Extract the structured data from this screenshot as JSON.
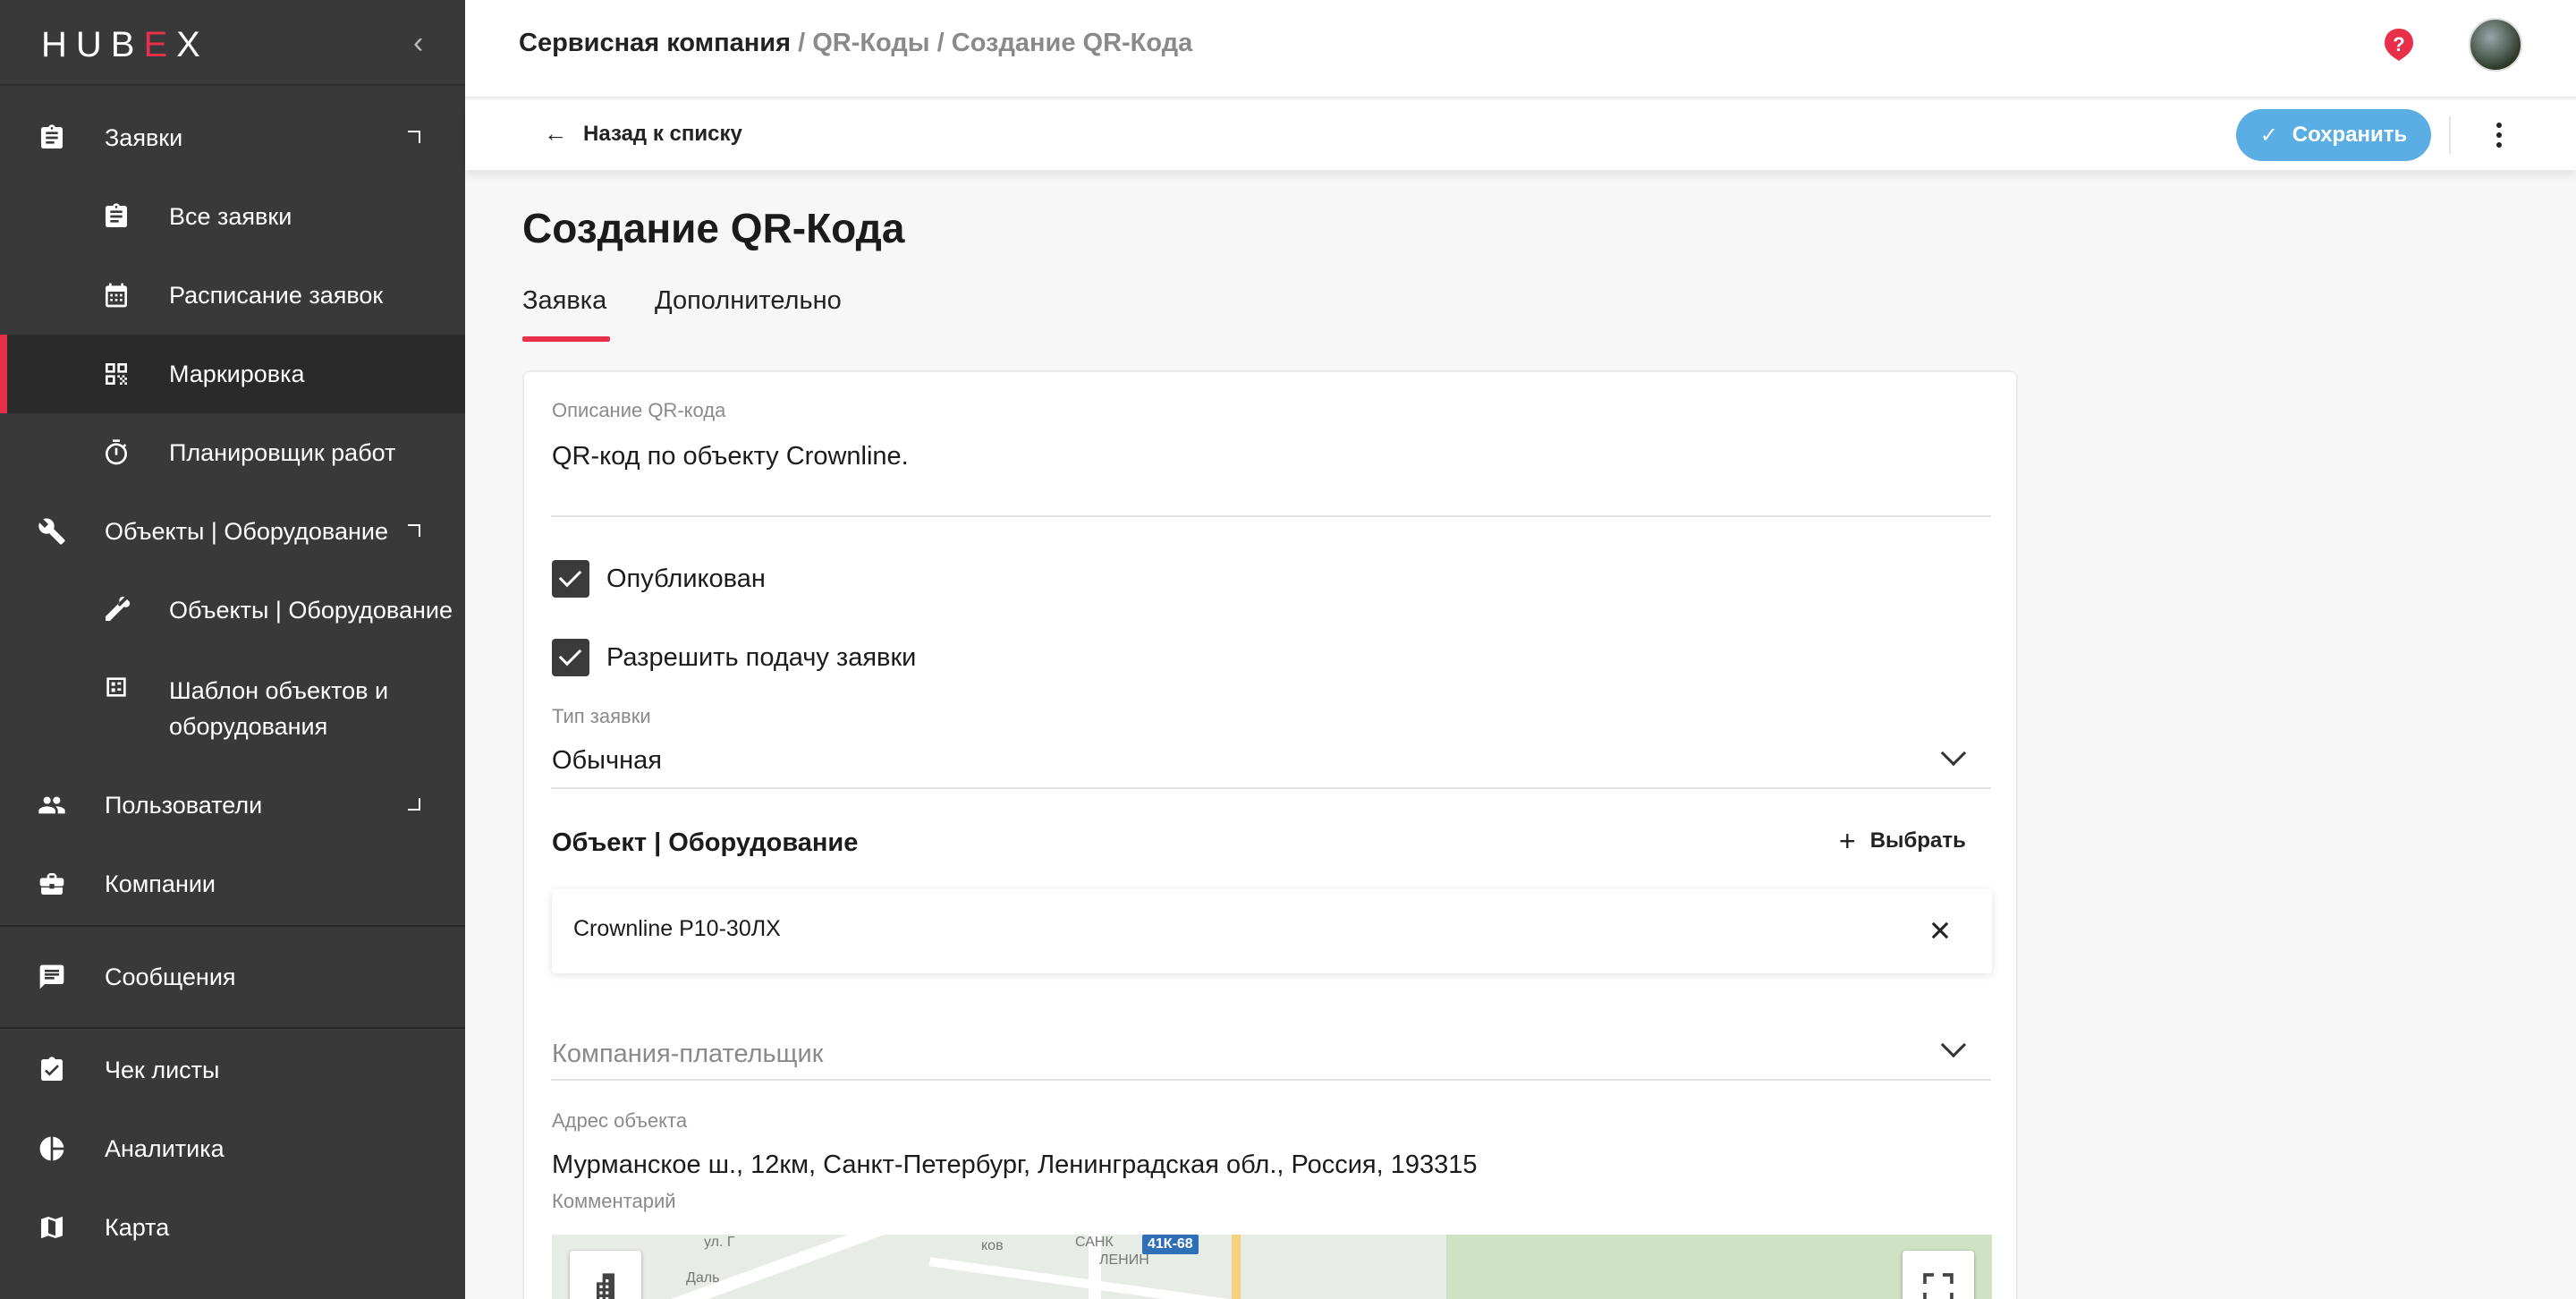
{
  "app": {
    "logo_pre": "HUB",
    "logo_accent": "E",
    "logo_post": "X"
  },
  "sidebar": {
    "collapse_glyph": "‹",
    "items": [
      {
        "label": "Заявки",
        "icon": "clipboard-icon"
      },
      {
        "label": "Все заявки",
        "icon": "clipboard-icon"
      },
      {
        "label": "Расписание заявок",
        "icon": "calendar-icon"
      },
      {
        "label": "Маркировка",
        "icon": "qr-code-icon"
      },
      {
        "label": "Планировщик работ",
        "icon": "stopwatch-icon"
      },
      {
        "label": "Объекты | Оборудование",
        "icon": "wrench-icon"
      },
      {
        "label": "Объекты | Оборудование",
        "icon": "tools-icon"
      },
      {
        "label": "Шаблон объектов и оборудования",
        "icon": "template-icon"
      },
      {
        "label": "Пользователи",
        "icon": "users-icon"
      },
      {
        "label": "Компании",
        "icon": "briefcase-icon"
      },
      {
        "label": "Сообщения",
        "icon": "message-icon"
      },
      {
        "label": "Чек листы",
        "icon": "checklist-icon"
      },
      {
        "label": "Аналитика",
        "icon": "pie-chart-icon"
      },
      {
        "label": "Карта",
        "icon": "map-icon"
      }
    ],
    "template_label_line1": "Шаблон объектов и",
    "template_label_line2": "оборудования"
  },
  "header": {
    "breadcrumb_root": "Сервисная компания",
    "breadcrumb_sep1": " / ",
    "breadcrumb_mid": "QR-Коды",
    "breadcrumb_sep2": " / ",
    "breadcrumb_current": "Создание QR-Кода"
  },
  "actions": {
    "back_label": "Назад к списку",
    "back_glyph": "←",
    "save_label": "Сохранить",
    "save_glyph": "✓"
  },
  "page": {
    "title": "Создание QR-Кода",
    "tabs": [
      {
        "label": "Заявка",
        "active": true
      },
      {
        "label": "Дополнительно",
        "active": false
      }
    ]
  },
  "form": {
    "description_label": "Описание QR-кода",
    "description_value": "QR-код по объекту Crownline.",
    "published_label": "Опубликован",
    "published_checked": true,
    "allow_request_label": "Разрешить подачу заявки",
    "allow_request_checked": true,
    "request_type_label": "Тип заявки",
    "request_type_value": "Обычная",
    "object_section_title": "Объект | Оборудование",
    "select_label": "Выбрать",
    "select_glyph": "+",
    "selected_object": "Crownline P10-30ЛХ",
    "payer_placeholder": "Компания-плательщик",
    "address_label": "Адрес объекта",
    "address_value": "Мурманское ш., 12км, Санкт-Петербург, Ленинградская обл., Россия, 193315",
    "comment_label": "Комментарий"
  },
  "map": {
    "road_badge": "41К-68",
    "labels": [
      "ул. Г",
      "Даль",
      "ков",
      "САНК",
      "ЛЕНИН"
    ]
  },
  "colors": {
    "accent": "#e8304a",
    "primary": "#5aaee3",
    "sidebar_bg": "#393939",
    "help": "#e8304a"
  }
}
